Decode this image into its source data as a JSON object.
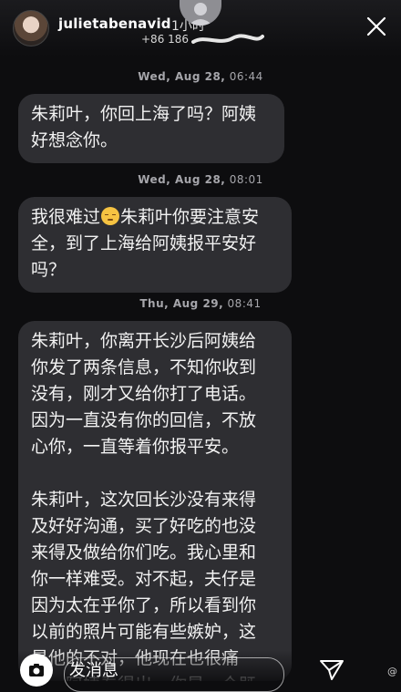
{
  "story": {
    "progress": 0.1
  },
  "header": {
    "username": "julietabenavid",
    "time_ago": "1小时",
    "phone": "+86 186",
    "close_icon": "close-icon"
  },
  "messages": [
    {
      "timestamp_day": "Wed, Aug 28,",
      "timestamp_time": "06:44",
      "text": "朱莉叶，你回上海了吗？阿姨\n好想念你。"
    },
    {
      "timestamp_day": "Wed, Aug 28,",
      "timestamp_time": "08:01",
      "text_before": "我很难过",
      "emoji": "pensive-face-emoji",
      "text_after": "朱莉叶你要注意安\n全，到了上海给阿姨报平安好\n吗？"
    },
    {
      "timestamp_day": "Thu, Aug 29,",
      "timestamp_time": "08:41",
      "text": "朱莉叶，你离开长沙后阿姨给\n你发了两条信息，不知你收到\n没有，刚才又给你打了电话。\n因为一直没有你的回信，不放\n心你，一直等着你报平安。\n\n朱莉叶，这次回长沙没有来得\n及好好沟通，买了好吃的也没\n来得及做给你们吃。我心里和\n你一样难受。对不起，夫仔是\n因为太在乎你了，所以看到你\n以前的照片可能有些嫉妒，这\n是他的不对，他现在也很痛\n苦。阿姨看得出，你是一个既\n美丽又善良的好女孩，你们失\n去交臂真的很遗憾，我们很惋"
    }
  ],
  "bottom": {
    "send_label": "发消息",
    "camera_icon": "camera-icon",
    "share_icon": "paper-plane-icon",
    "watermark": "@"
  }
}
